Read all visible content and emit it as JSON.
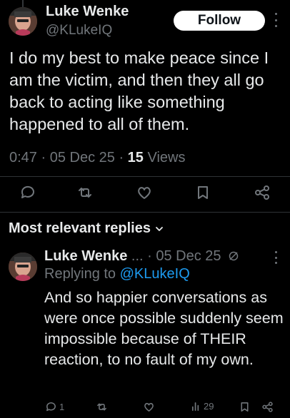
{
  "post": {
    "author_name": "Luke Wenke",
    "author_handle": "@KLukeIQ",
    "follow_label": "Follow",
    "text": "I do my best to make peace since I am the victim, and then they all go back to acting like something happened to all of them.",
    "time": "0:47",
    "date": "05 Dec 25",
    "views_count": "15",
    "views_label": "Views",
    "icons": [
      "reply-icon",
      "repost-icon",
      "like-icon",
      "bookmark-icon",
      "share-icon"
    ]
  },
  "replies_section": {
    "header": "Most relevant replies",
    "icon": "chevron-down-icon"
  },
  "reply": {
    "author_name": "Luke Wenke",
    "ellipsis": "...",
    "date": "05 Dec 25",
    "replying_prefix": "Replying to",
    "replying_to": "@KLukeIQ",
    "text": "And so happier conversations as were once possible suddenly seem impossible because of THEIR reaction, to no fault of my own.",
    "reply_count": "1",
    "views_count": "29",
    "icons": [
      "reply-icon",
      "repost-icon",
      "like-icon",
      "views-icon",
      "bookmark-icon",
      "share-icon",
      "muted-icon"
    ]
  },
  "colors": {
    "background": "#000000",
    "text_primary": "#e7e9ea",
    "text_secondary": "#71767b",
    "accent": "#1d9bf0",
    "divider": "#2f3336"
  }
}
